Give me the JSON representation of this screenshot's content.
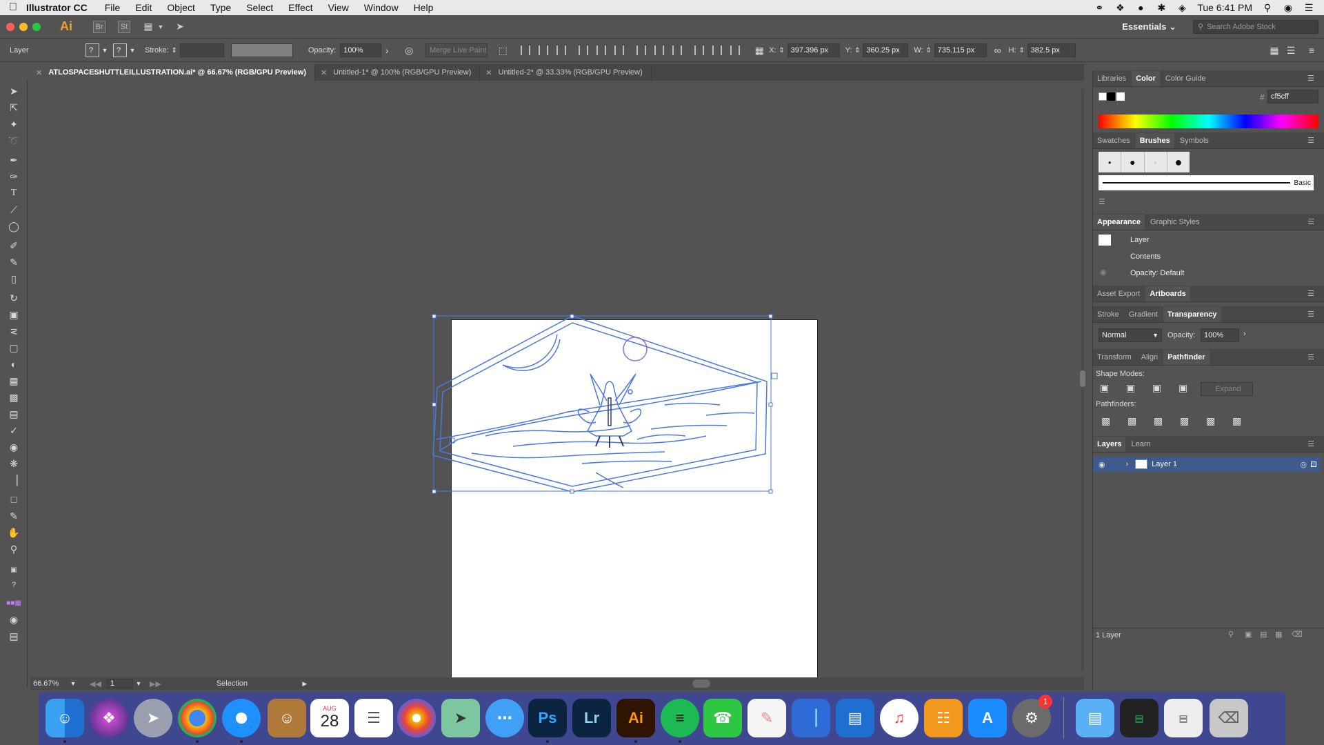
{
  "menubar": {
    "app_name": "Illustrator CC",
    "items": [
      "File",
      "Edit",
      "Object",
      "Type",
      "Select",
      "Effect",
      "View",
      "Window",
      "Help"
    ],
    "clock": "Tue 6:41 PM"
  },
  "appbar": {
    "logo": "Ai",
    "bridge": "Br",
    "stock": "St",
    "workspace": "Essentials",
    "search_placeholder": "Search Adobe Stock"
  },
  "control": {
    "selection_type": "Layer",
    "stroke_label": "Stroke:",
    "opacity_label": "Opacity:",
    "opacity_value": "100%",
    "merge_live_paint": "Merge Live Paint",
    "x_label": "X:",
    "x_value": "397.396 px",
    "y_label": "Y:",
    "y_value": "360.25 px",
    "w_label": "W:",
    "w_value": "735.115 px",
    "h_label": "H:",
    "h_value": "382.5 px"
  },
  "tabs": [
    {
      "label": "ATLOSPACESHUTTLEILLUSTRATION.ai* @ 66.67% (RGB/GPU Preview)"
    },
    {
      "label": "Untitled-1* @ 100% (RGB/GPU Preview)"
    },
    {
      "label": "Untitled-2* @ 33.33% (RGB/GPU Preview)"
    }
  ],
  "status": {
    "zoom": "66.67%",
    "artboard_number": "1",
    "tool": "Selection"
  },
  "panels": {
    "color_tabs": [
      "Libraries",
      "Color",
      "Color Guide"
    ],
    "color_hex": "cf5cff",
    "brush_tabs": [
      "Swatches",
      "Brushes",
      "Symbols"
    ],
    "brush_basic": "Basic",
    "appearance_tabs": [
      "Appearance",
      "Graphic Styles"
    ],
    "appearance_rows": [
      "Layer",
      "Contents",
      "Opacity: Default"
    ],
    "artboard_tabs": [
      "Asset Export",
      "Artboards"
    ],
    "transparency_tabs": [
      "Stroke",
      "Gradient",
      "Transparency"
    ],
    "blend_mode": "Normal",
    "opacity_label": "Opacity:",
    "opacity_value": "100%",
    "pathfinder_tabs": [
      "Transform",
      "Align",
      "Pathfinder"
    ],
    "shape_modes": "Shape Modes:",
    "expand": "Expand",
    "pathfinders": "Pathfinders:",
    "layers_tabs": [
      "Layers",
      "Learn"
    ],
    "layer_name": "Layer 1",
    "layer_count": "1 Layer"
  },
  "dock": {
    "calendar_month": "AUG",
    "calendar_day": "28",
    "photoshop": "Ps",
    "lightroom": "Lr",
    "illustrator": "Ai",
    "badge": "1"
  },
  "colors": {
    "selection_blue": "#4a78e0",
    "menubar": "#e9e9ec",
    "ui_gray": "#535353",
    "dock": "#3e4696"
  }
}
